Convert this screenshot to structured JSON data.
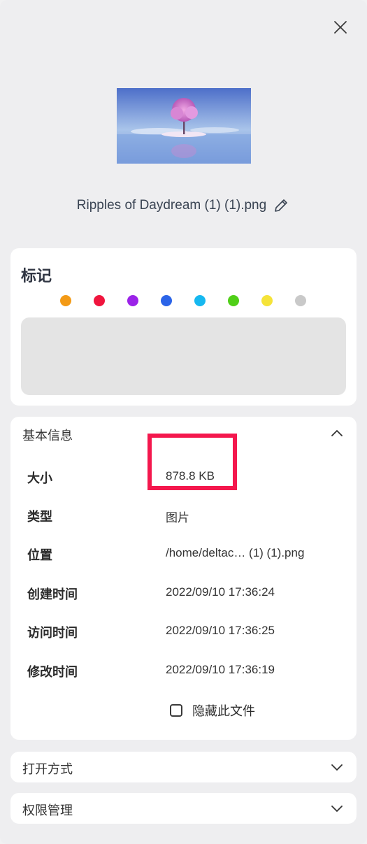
{
  "file": {
    "name": "Ripples of Daydream (1) (1).png"
  },
  "tags": {
    "title": "标记",
    "colors": [
      "#f39a16",
      "#f0153e",
      "#9b23e8",
      "#2b64e8",
      "#16b8f0",
      "#50cf18",
      "#f5e339",
      "#c9c9c9"
    ]
  },
  "basic_info": {
    "title": "基本信息",
    "rows": [
      {
        "key": "大小",
        "value": "878.8 KB"
      },
      {
        "key": "类型",
        "value": "图片"
      },
      {
        "key": "位置",
        "value": "/home/deltac… (1) (1).png"
      },
      {
        "key": "创建时间",
        "value": "2022/09/10 17:36:24"
      },
      {
        "key": "访问时间",
        "value": "2022/09/10 17:36:25"
      },
      {
        "key": "修改时间",
        "value": "2022/09/10 17:36:19"
      }
    ],
    "hide_file_label": "隐藏此文件"
  },
  "open_with": {
    "title": "打开方式"
  },
  "permissions": {
    "title": "权限管理"
  }
}
